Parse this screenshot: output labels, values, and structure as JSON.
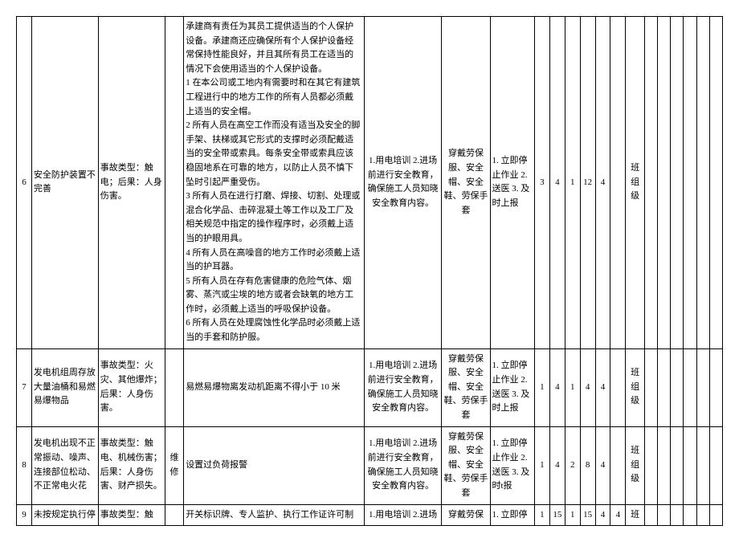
{
  "rows": [
    {
      "id": "6",
      "item": "安全防护装置不完善",
      "type": "事故类型：触电；后果：人身伤害。",
      "extra": "",
      "measures": "承建商有责任为其员工提供适当的个人保护设备。承建商还应确保所有个人保护设备经常保持性能良好，并且其所有员工在适当的情况下会使用适当的个人保护设备。\n1 在本公司或工地内有需要时和在其它有建筑工程进行中的地方工作的所有人员都必须戴上适当的安全帽。\n2 所有人员在高空工作而没有适当及安全的脚手架、扶梯或其它形式的支撑时必须配戴适当的安全带或索具。每条安全带或索具应该稳固地系在可靠的地方，以防止人员不慎下坠时引起严重受伤。\n3 所有人员在进行打磨、焊接、切割、处理或混合化学品、击碎混凝土等工作以及工厂及相关规范中指定的操作程序时，必须戴上适当的护眼用具。\n4 所有人员在高噪音的地方工作时必须戴上适当的护耳器。\n5 所有人员在存有危害健康的危险气体、烟雾、蒸汽或尘埃的地方或者会缺氧的地方工作时，必须戴上适当的呼吸保护设备。\n6 所有人员在处理腐蚀性化学品时必须戴上适当的手套和防护服。",
      "training": "1.用电培训 2.进场前进行安全教育，确保施工人员知晓安全教育内容。",
      "ppe": "穿戴劳保服、安全帽、安全鞋、劳保手套",
      "emergency": "1. 立即停止作业 2. 送医 3. 及时上报",
      "n1": "3",
      "n2": "4",
      "n3": "1",
      "n4": "12",
      "n5": "4",
      "n6": "",
      "level": "班组级"
    },
    {
      "id": "7",
      "item": "发电机组周存放大量油桶和易燃易爆物品",
      "type": "事故类型：火灾、其他爆炸；后果：人身伤害。",
      "extra": "",
      "measures": "易燃易爆物离发动机距离不得小于 10 米",
      "training": "1.用电培训 2.进场前进行安全教育，确保施工人员知晓安全教育内容。",
      "ppe": "穿戴劳保服、安全帽、安全鞋、劳保手套",
      "emergency": "1. 立即停止作业 2. 送医 3. 及时上报",
      "n1": "1",
      "n2": "4",
      "n3": "1",
      "n4": "4",
      "n5": "4",
      "n6": "",
      "level": "班组级"
    },
    {
      "id": "8",
      "item": "发电机出现不正常振动、噪声、连接部位松动、不正常电火花",
      "type": "事故类型：触电、机械伤害；后果：人身伤害、财产损失。",
      "extra": "维修",
      "measures": "设置过负荷报警",
      "training": "1.用电培训 2.进场前进行安全教育，确保施工人员知晓安全教育内容。",
      "ppe": "穿戴劳保服、安全帽、安全鞋、劳保手套",
      "emergency": "1. 立即停止作业 2. 送医 3. 及时t报",
      "n1": "1",
      "n2": "4",
      "n3": "2",
      "n4": "8",
      "n5": "4",
      "n6": "",
      "level": "班组级"
    },
    {
      "id": "9",
      "item": "未按规定执行停",
      "type": "事故类型：触",
      "extra": "",
      "measures": "开关标识牌、专人监护、执行工作证许可制",
      "training": "1.用电培训 2.进场",
      "ppe": "穿戴劳保",
      "emergency": "1. 立即停",
      "n1": "1",
      "n2": "15",
      "n3": "1",
      "n4": "15",
      "n5": "4",
      "n6": "4",
      "level": "班"
    }
  ]
}
